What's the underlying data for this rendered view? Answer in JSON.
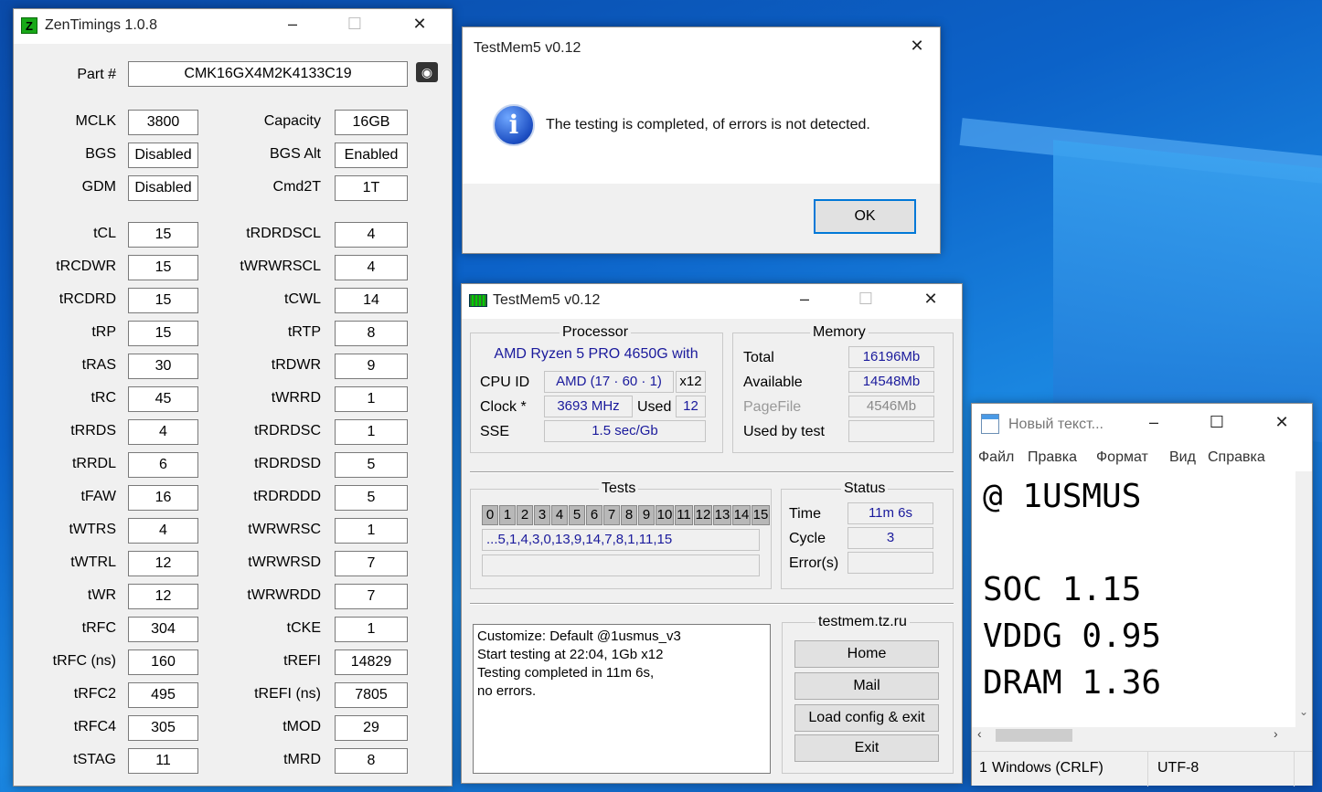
{
  "zen": {
    "title": "ZenTimings 1.0.8",
    "logo_letter": "Z",
    "part_label": "Part #",
    "part_value": "CMK16GX4M2K4133C19",
    "rows": [
      {
        "l": "MCLK",
        "lv": "3800",
        "r": "Capacity",
        "rv": "16GB"
      },
      {
        "l": "BGS",
        "lv": "Disabled",
        "r": "BGS Alt",
        "rv": "Enabled"
      },
      {
        "l": "GDM",
        "lv": "Disabled",
        "r": "Cmd2T",
        "rv": "1T"
      },
      {
        "l": "tCL",
        "lv": "15",
        "r": "tRDRDSCL",
        "rv": "4"
      },
      {
        "l": "tRCDWR",
        "lv": "15",
        "r": "tWRWRSCL",
        "rv": "4"
      },
      {
        "l": "tRCDRD",
        "lv": "15",
        "r": "tCWL",
        "rv": "14"
      },
      {
        "l": "tRP",
        "lv": "15",
        "r": "tRTP",
        "rv": "8"
      },
      {
        "l": "tRAS",
        "lv": "30",
        "r": "tRDWR",
        "rv": "9"
      },
      {
        "l": "tRC",
        "lv": "45",
        "r": "tWRRD",
        "rv": "1"
      },
      {
        "l": "tRRDS",
        "lv": "4",
        "r": "tRDRDSC",
        "rv": "1"
      },
      {
        "l": "tRRDL",
        "lv": "6",
        "r": "tRDRDSD",
        "rv": "5"
      },
      {
        "l": "tFAW",
        "lv": "16",
        "r": "tRDRDDD",
        "rv": "5"
      },
      {
        "l": "tWTRS",
        "lv": "4",
        "r": "tWRWRSC",
        "rv": "1"
      },
      {
        "l": "tWTRL",
        "lv": "12",
        "r": "tWRWRSD",
        "rv": "7"
      },
      {
        "l": "tWR",
        "lv": "12",
        "r": "tWRWRDD",
        "rv": "7"
      },
      {
        "l": "tRFC",
        "lv": "304",
        "r": "tCKE",
        "rv": "1"
      },
      {
        "l": "tRFC (ns)",
        "lv": "160",
        "r": "tREFI",
        "rv": "14829"
      },
      {
        "l": "tRFC2",
        "lv": "495",
        "r": "tREFI (ns)",
        "rv": "7805"
      },
      {
        "l": "tRFC4",
        "lv": "305",
        "r": "tMOD",
        "rv": "29"
      },
      {
        "l": "tSTAG",
        "lv": "11",
        "r": "tMRD",
        "rv": "8"
      }
    ]
  },
  "dialog": {
    "title": "TestMem5 v0.12",
    "message": "The testing is completed, of errors is not detected.",
    "ok": "OK",
    "icon_glyph": "i"
  },
  "tm": {
    "title": "TestMem5 v0.12",
    "processor": {
      "heading": "Processor",
      "name": "AMD Ryzen 5 PRO 4650G with",
      "cpuid_label": "CPU ID",
      "cpuid": "AMD  (17 · 60 · 1)",
      "threads": "x12",
      "clock_label": "Clock *",
      "clock": "3693 MHz",
      "used_label": "Used",
      "used": "12",
      "sse_label": "SSE",
      "sse": "1.5 sec/Gb"
    },
    "memory": {
      "heading": "Memory",
      "total_label": "Total",
      "total": "16196Mb",
      "available_label": "Available",
      "available": "14548Mb",
      "pagefile_label": "PageFile",
      "pagefile": "4546Mb",
      "usedbytest_label": "Used by test",
      "usedbytest": ""
    },
    "tests": {
      "heading": "Tests",
      "cells": [
        "0",
        "1",
        "2",
        "3",
        "4",
        "5",
        "6",
        "7",
        "8",
        "9",
        "10",
        "11",
        "12",
        "13",
        "14",
        "15"
      ],
      "sequence": "...5,1,4,3,0,13,9,14,7,8,1,11,15",
      "extra": ""
    },
    "status": {
      "heading": "Status",
      "time_label": "Time",
      "time": "11m 6s",
      "cycle_label": "Cycle",
      "cycle": "3",
      "errors_label": "Error(s)",
      "errors": ""
    },
    "log": [
      "Customize: Default @1usmus_v3",
      "Start testing at 22:04, 1Gb x12",
      "Testing completed in 11m 6s,",
      "no errors."
    ],
    "site": "testmem.tz.ru",
    "buttons": {
      "home": "Home",
      "mail": "Mail",
      "load": "Load config & exit",
      "exit": "Exit"
    }
  },
  "notepad": {
    "title": "Новый текст...",
    "menu": [
      "Файл",
      "Правка",
      "Формат",
      "Вид",
      "Справка"
    ],
    "lines": [
      "@ 1USMUS",
      "",
      "SOC 1.15",
      "VDDG 0.95",
      "DRAM 1.36"
    ],
    "status_pos": "1",
    "status_eol": "Windows (CRLF)",
    "status_enc": "UTF-8"
  }
}
